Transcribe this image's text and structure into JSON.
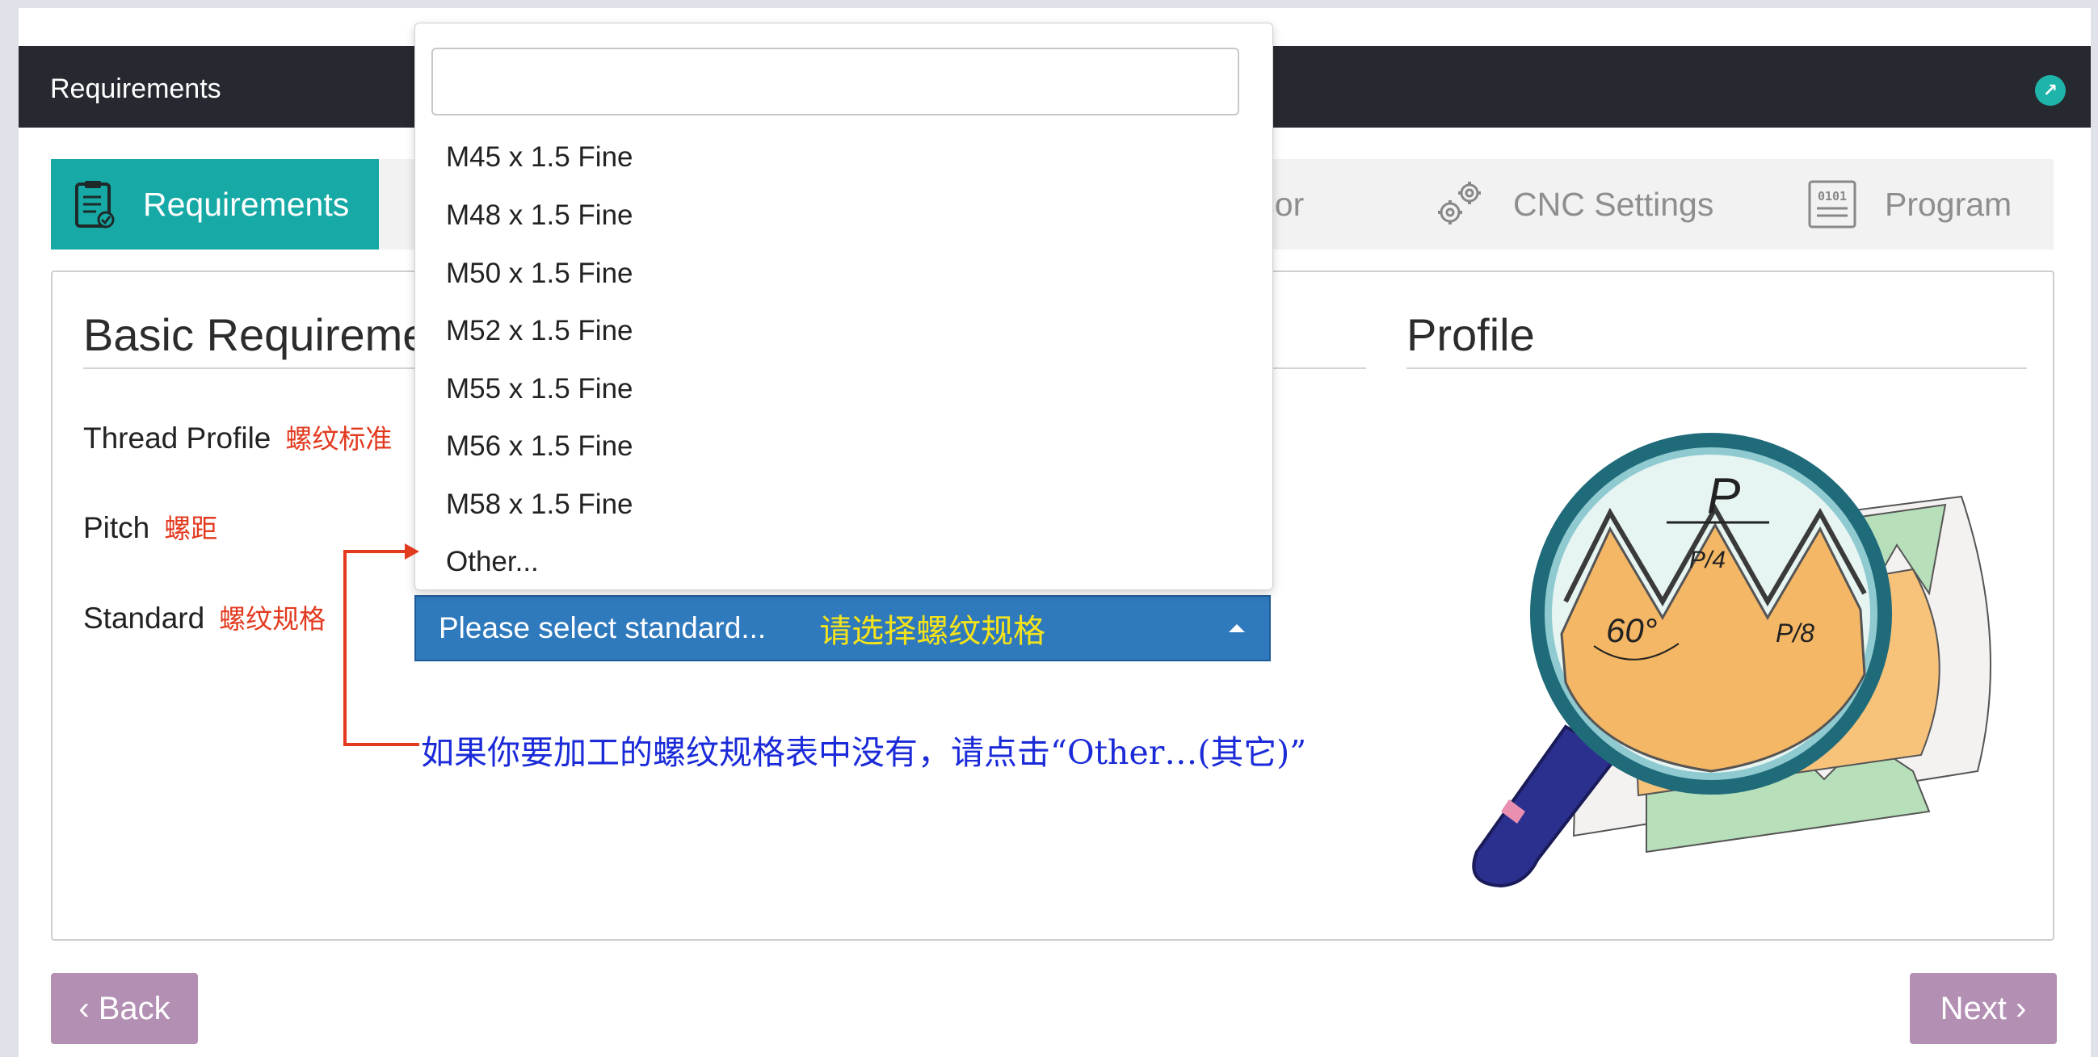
{
  "window": {
    "title": "Requirements"
  },
  "steps": [
    {
      "label": "Requirements",
      "active": true,
      "icon": "clipboard-icon"
    },
    {
      "label": "essor",
      "active": false,
      "icon": "processor-icon"
    },
    {
      "label": "CNC Settings",
      "active": false,
      "icon": "gears-icon"
    },
    {
      "label": "Program",
      "active": false,
      "icon": "binary-file-icon"
    }
  ],
  "basic": {
    "title": "Basic Requireme",
    "fields": [
      {
        "label": "Thread Profile",
        "note": "螺纹标准"
      },
      {
        "label": "Pitch",
        "note": "螺距"
      },
      {
        "label": "Standard",
        "note": "螺纹规格"
      }
    ]
  },
  "profile": {
    "title": "Profile"
  },
  "select": {
    "placeholder": "Please select standard...",
    "note": "请选择螺纹规格"
  },
  "dropdown": {
    "search_value": "",
    "options": [
      "M45 x 1.5 Fine",
      "M48 x 1.5 Fine",
      "M50 x 1.5 Fine",
      "M52 x 1.5 Fine",
      "M55 x 1.5 Fine",
      "M56 x 1.5 Fine",
      "M58 x 1.5 Fine",
      "Other..."
    ]
  },
  "annotation": {
    "text": "如果你要加工的螺纹规格表中没有，请点击“Other…(其它)”"
  },
  "illustration": {
    "pitch": "P",
    "quarter": "P/4",
    "eighth": "P/8",
    "angle": "60°"
  },
  "nav": {
    "back": "‹ Back",
    "next": "Next ›"
  },
  "colors": {
    "accent": "#16a9a6",
    "titlebar": "#262a30",
    "select": "#2f79bd",
    "nav_button": "#b48fb4",
    "annotation_red": "#e23a1f",
    "annotation_blue": "#1a2ad8"
  }
}
